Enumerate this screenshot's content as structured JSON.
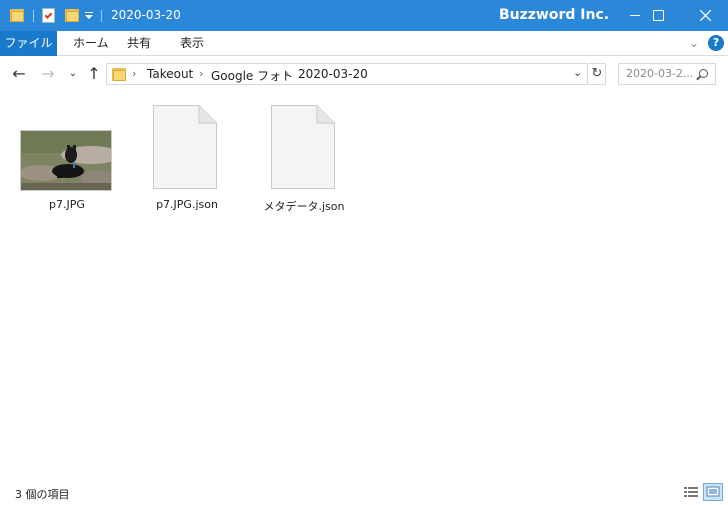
{
  "window": {
    "title": "2020-03-20",
    "brand": "Buzzword Inc."
  },
  "ribbon": {
    "tabs": [
      "ファイル",
      "ホーム",
      "共有",
      "表示"
    ]
  },
  "address": {
    "path": [
      "Takeout",
      "Google フォト",
      "2020-03-20"
    ]
  },
  "search": {
    "placeholder": "2020-03-2..."
  },
  "files": [
    {
      "name": "p7.JPG",
      "icon": "photo-thumbnail"
    },
    {
      "name": "p7.JPG.json",
      "icon": "document-icon"
    },
    {
      "name": "メタデータ.json",
      "icon": "document-icon"
    }
  ],
  "status": {
    "count_text": "3 個の項目"
  },
  "colors": {
    "titlebar": "#2b88d8",
    "file_tab": "#1979ca",
    "folder": "#f8d775"
  }
}
